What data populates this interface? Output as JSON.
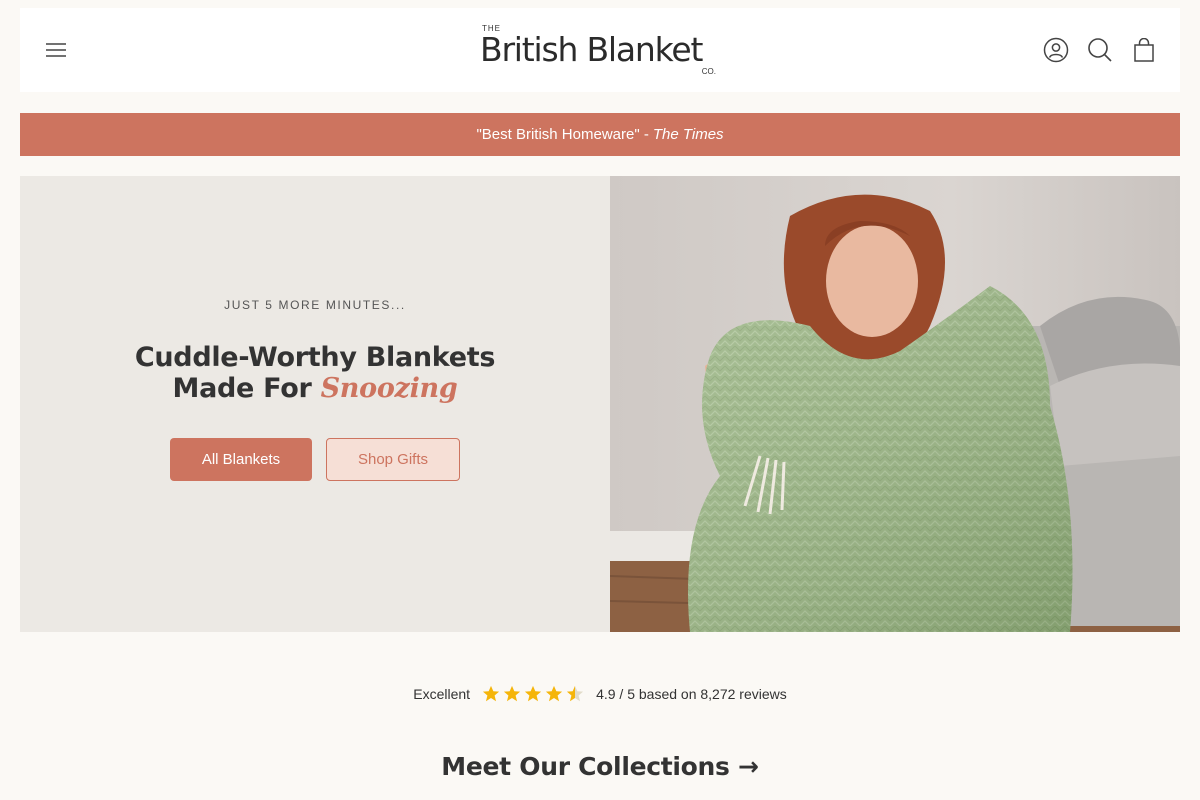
{
  "header": {
    "logo": {
      "the": "THE",
      "main": "British Blanket",
      "co": "CO."
    }
  },
  "announcement": {
    "quote": "\"Best British Homeware\" -",
    "source": "The Times"
  },
  "hero": {
    "eyebrow": "JUST 5 MORE MINUTES...",
    "title_main": "Cuddle-Worthy Blankets Made For",
    "title_accent": "Snoozing",
    "primary_button": "All Blankets",
    "secondary_button": "Shop Gifts"
  },
  "reviews": {
    "rating_word": "Excellent",
    "rating": 4.9,
    "summary": "4.9 / 5 based on 8,272 reviews"
  },
  "collections": {
    "title": "Meet Our Collections →"
  },
  "colors": {
    "accent": "#cd745f",
    "hero_panel": "#ece9e4",
    "star": "#f5b50a",
    "blanket": "#9bb585"
  },
  "icons": [
    "menu-icon",
    "account-icon",
    "search-icon",
    "bag-icon",
    "star-icon"
  ]
}
